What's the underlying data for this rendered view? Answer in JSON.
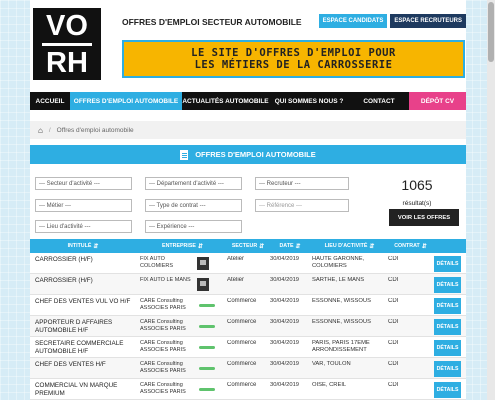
{
  "header": {
    "logo_top": "VO",
    "logo_bottom": "RH",
    "site_title": "OFFRES D'EMPLOI SECTEUR AUTOMOBILE",
    "btn_candidates": "ESPACE CANDIDATS",
    "btn_recruiters": "ESPACE RECRUTEURS",
    "banner_line1": "LE SITE D'OFFRES D'EMPLOI POUR",
    "banner_line2": "LES MÉTIERS DE LA CARROSSERIE",
    "colors": {
      "accent": "#2eaee2",
      "banner": "#f7b500",
      "depot": "#e8418a",
      "dark": "#111111"
    }
  },
  "nav": {
    "items": [
      {
        "label": "ACCUEIL"
      },
      {
        "label": "OFFRES D'EMPLOI AUTOMOBILE"
      },
      {
        "label": "ACTUALITÉS AUTOMOBILE"
      },
      {
        "label": "QUI SOMMES NOUS ?"
      },
      {
        "label": "CONTACT"
      },
      {
        "label": "DÉPÔT CV"
      }
    ]
  },
  "breadcrumb": {
    "home_icon": "home-icon",
    "current": "Offres d'emploi automobile"
  },
  "section": {
    "title": "OFFRES D'EMPLOI AUTOMOBILE",
    "icon": "document-icon"
  },
  "filters": {
    "sector": "--- Secteur d'activité ---",
    "department": "--- Département d'activité ---",
    "recruiter": "--- Recruteur ---",
    "job": "--- Métier ---",
    "contract_type": "--- Type de contrat ---",
    "reference_placeholder": "--- Référence ---",
    "place": "--- Lieu d'activité ---",
    "experience": "--- Expérience ---"
  },
  "results": {
    "count": "1065",
    "label": "résultat(s)",
    "see_offers": "VOIR LES OFFRES"
  },
  "table": {
    "headers": [
      "INTITULÉ",
      "ENTREPRISE",
      "SECTEUR",
      "DATE",
      "LIEU D'ACTIVITÉ",
      "CONTRAT"
    ],
    "details_label": "DÉTAILS",
    "rows": [
      {
        "title": "CARROSSIER (H/F)",
        "company": "FIX AUTO COLOMIERS",
        "logo": "fix",
        "sector": "Atelier",
        "date": "30/04/2019",
        "place": "HAUTE GARONNE, COLOMIERS",
        "contract": "CDI"
      },
      {
        "title": "CARROSSIER (H/F)",
        "company": "FIX AUTO LE MANS",
        "logo": "fix",
        "sector": "Atelier",
        "date": "30/04/2019",
        "place": "SARTHE, LE MANS",
        "contract": "CDI"
      },
      {
        "title": "CHEF DES VENTES VUL VO H/F",
        "company": "CARE Consulting ASSOCIES PARIS",
        "logo": "care",
        "sector": "Commerce",
        "date": "30/04/2019",
        "place": "ESSONNE, WISSOUS",
        "contract": "CDI"
      },
      {
        "title": "APPORTEUR D AFFAIRES AUTOMOBILE H/F",
        "company": "CARE Consulting ASSOCIES PARIS",
        "logo": "care",
        "sector": "Commerce",
        "date": "30/04/2019",
        "place": "ESSONNE, WISSOUS",
        "contract": "CDI"
      },
      {
        "title": "SECRETAIRE COMMERCIALE AUTOMOBILE H/F",
        "company": "CARE Consulting ASSOCIES PARIS",
        "logo": "care",
        "sector": "Commerce",
        "date": "30/04/2019",
        "place": "PARIS, PARIS 17EME ARRONDISSEMENT",
        "contract": "CDI"
      },
      {
        "title": "CHEF DES VENTES H/F",
        "company": "CARE Consulting ASSOCIES PARIS",
        "logo": "care",
        "sector": "Commerce",
        "date": "30/04/2019",
        "place": "VAR, TOULON",
        "contract": "CDI"
      },
      {
        "title": "COMMERCIAL VN MARQUE PREMIUM",
        "company": "CARE Consulting ASSOCIES PARIS",
        "logo": "care",
        "sector": "Commerce",
        "date": "30/04/2019",
        "place": "OISE, CREIL",
        "contract": "CDI"
      }
    ]
  }
}
